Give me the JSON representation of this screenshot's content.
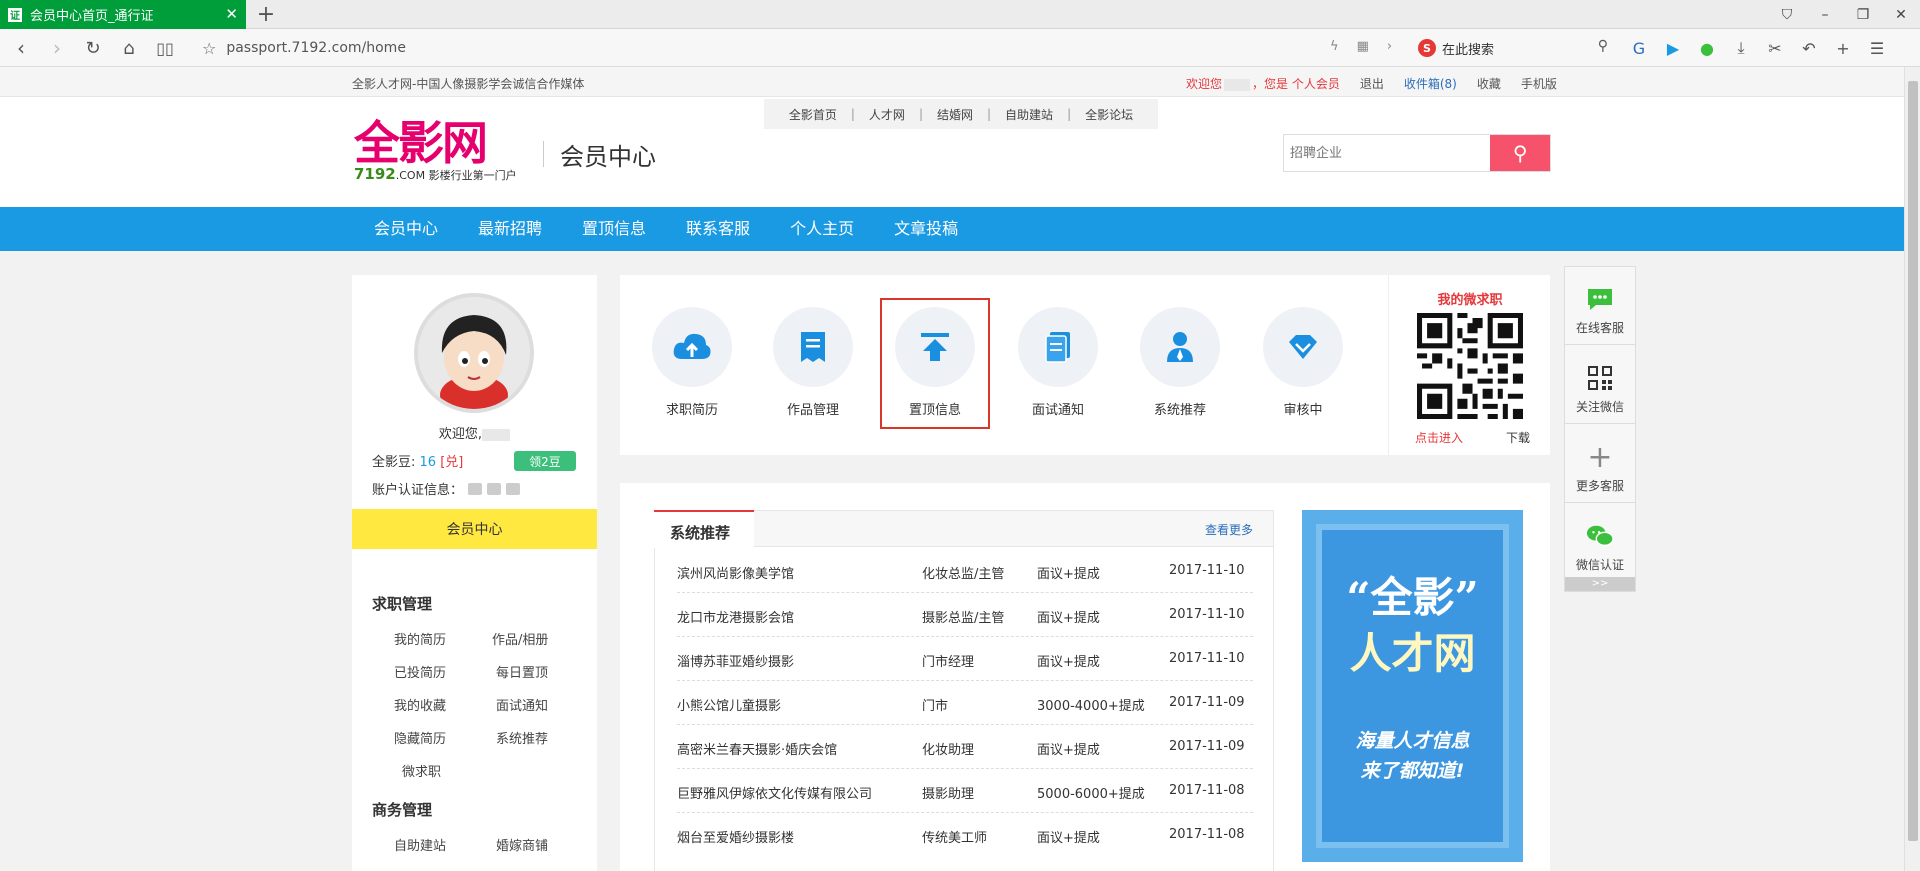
{
  "browser": {
    "tab_title": "会员中心首页_通行证",
    "url": "passport.7192.com/home",
    "search_placeholder": "在此搜索",
    "search_logo": "S"
  },
  "topbar": {
    "slogan": "全影人才网-中国人像摄影学会诚信合作媒体",
    "welcome": "欢迎您",
    "member_type": "，您是 个人会员",
    "logout": "退出",
    "inbox": "收件箱(8)",
    "favorites": "收藏",
    "mobile": "手机版"
  },
  "header": {
    "logo_text": "全影网",
    "logo_domain": "7192",
    "logo_suffix": ".COM 影楼行业第一门户",
    "center_title": "会员中心",
    "toplinks": [
      "全影首页",
      "人才网",
      "结婚网",
      "自助建站",
      "全影论坛"
    ],
    "search_placeholder": "招聘企业"
  },
  "mainnav": [
    "会员中心",
    "最新招聘",
    "置顶信息",
    "联系客服",
    "个人主页",
    "文章投稿"
  ],
  "sidebar": {
    "welcome": "欢迎您,",
    "beans_label": "全影豆: ",
    "beans_value": "16",
    "beans_exchange": "兑",
    "get_beans": "领2豆",
    "verify_label": "账户认证信息：",
    "member_center": "会员中心",
    "job_section": "求职管理",
    "job_items": [
      "我的简历",
      "作品/相册",
      "已投简历",
      "每日置顶",
      "我的收藏",
      "面试通知",
      "隐藏简历",
      "系统推荐",
      "微求职"
    ],
    "biz_section": "商务管理",
    "biz_items": [
      "自助建站",
      "婚嫁商铺"
    ]
  },
  "icons": [
    {
      "label": "求职简历",
      "icon": "cloud-upload-icon"
    },
    {
      "label": "作品管理",
      "icon": "document-icon"
    },
    {
      "label": "置顶信息",
      "icon": "pin-top-icon"
    },
    {
      "label": "面试通知",
      "icon": "notice-icon"
    },
    {
      "label": "系统推荐",
      "icon": "person-icon"
    },
    {
      "label": "审核中",
      "icon": "diamond-icon"
    }
  ],
  "qr": {
    "title": "我的微求职",
    "enter": "点击进入",
    "download": "下载"
  },
  "recommend": {
    "title": "系统推荐",
    "more": "查看更多",
    "rows": [
      {
        "company": "滨州风尚影像美学馆",
        "position": "化妆总监/主管",
        "salary": "面议+提成",
        "date": "2017-11-10"
      },
      {
        "company": "龙口市龙港摄影会馆",
        "position": "摄影总监/主管",
        "salary": "面议+提成",
        "date": "2017-11-10"
      },
      {
        "company": "淄博苏菲亚婚纱摄影",
        "position": "门市经理",
        "salary": "面议+提成",
        "date": "2017-11-10"
      },
      {
        "company": "小熊公馆儿童摄影",
        "position": "门市",
        "salary": "3000-4000+提成",
        "date": "2017-11-09"
      },
      {
        "company": "高密米兰春天摄影·婚庆会馆",
        "position": "化妆助理",
        "salary": "面议+提成",
        "date": "2017-11-09"
      },
      {
        "company": "巨野雅风伊嫁依文化传媒有限公司",
        "position": "摄影助理",
        "salary": "5000-6000+提成",
        "date": "2017-11-08"
      },
      {
        "company": "烟台至爱婚纱摄影楼",
        "position": "传统美工师",
        "salary": "面议+提成",
        "date": "2017-11-08"
      }
    ]
  },
  "banner": {
    "line1": "“全影”",
    "line2": "人才网",
    "line3": "海量人才信息",
    "line4": "来了都知道!"
  },
  "float": [
    "在线客服",
    "关注微信",
    "更多客服",
    "微信认证"
  ],
  "float_more": ">>",
  "colors": {
    "nav_blue": "#1a9ae3",
    "accent_red": "#e4393c",
    "brand_pink": "#e5006d",
    "yellow": "#ffe940"
  }
}
